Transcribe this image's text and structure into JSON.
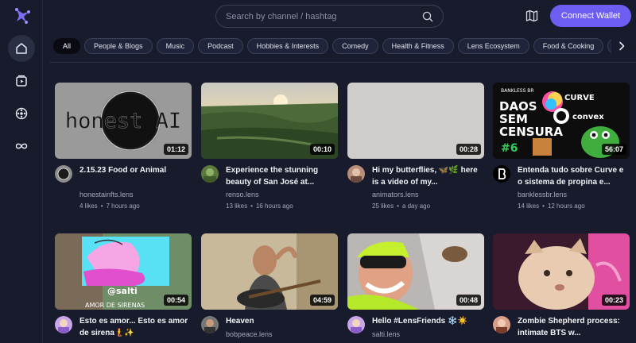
{
  "search": {
    "placeholder": "Search by channel / hashtag"
  },
  "header": {
    "connect_label": "Connect Wallet"
  },
  "chips": [
    "All",
    "People & Blogs",
    "Music",
    "Podcast",
    "Hobbies & Interests",
    "Comedy",
    "Health & Fitness",
    "Lens Ecosystem",
    "Food & Cooking",
    "E"
  ],
  "videos": [
    {
      "title": "2.15.23 Food or Animal",
      "channel": "honestainfts.lens",
      "likes": "4 likes",
      "time": "7 hours ago",
      "duration": "01:12",
      "thumb_text": "honest AI"
    },
    {
      "title": "Experience the stunning beauty of San José at...",
      "channel": "renso.lens",
      "likes": "13 likes",
      "time": "16 hours ago",
      "duration": "00:10"
    },
    {
      "title": "Hi my butterflies, 🦋🌿 here is a video of my...",
      "channel": "animators.lens",
      "likes": "25 likes",
      "time": "a day ago",
      "duration": "00:28"
    },
    {
      "title": "Entenda tudo sobre Curve e o sistema de propina e...",
      "channel": "banklessbr.lens",
      "likes": "14 likes",
      "time": "12 hours ago",
      "duration": "56:07",
      "thumb_text": [
        "DAOS",
        "SEM",
        "CENSURA",
        "#6",
        "CURVE",
        "convex",
        "BANKLESS BR"
      ]
    },
    {
      "title": "Esto es amor... Esto es amor de sirena🧜✨",
      "channel": "",
      "likes": "",
      "time": "",
      "duration": "00:54",
      "thumb_text": [
        "@salti",
        "AMOR DE SIRENAS"
      ]
    },
    {
      "title": "Heaven",
      "channel": "bobpeace.lens",
      "likes": "",
      "time": "",
      "duration": "04:59"
    },
    {
      "title": "Hello #LensFriends ❄️☀️",
      "channel": "salti.lens",
      "likes": "",
      "time": "",
      "duration": "00:48"
    },
    {
      "title": "Zombie Shepherd process: intimate BTS w...",
      "channel": "",
      "likes": "",
      "time": "",
      "duration": "00:23"
    }
  ],
  "colors": {
    "accent": "#6d5df0",
    "background": "#181b2b",
    "chip_active": "#0a0b12"
  },
  "icons": [
    "logo-icon",
    "home-icon",
    "library-icon",
    "explore-icon",
    "bytes-icon",
    "search-icon",
    "map-icon",
    "chevron-right-icon"
  ]
}
